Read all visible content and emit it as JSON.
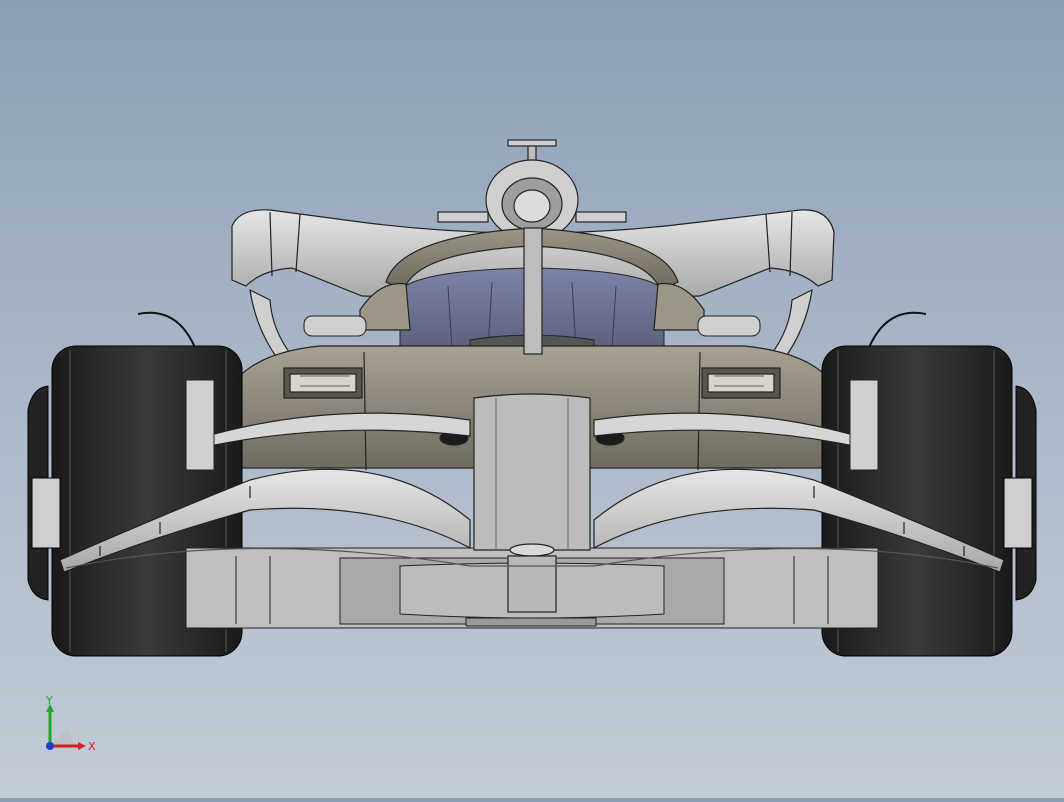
{
  "viewport": {
    "background_top": "#8d9fb6",
    "background_bottom": "#c3ccd6",
    "model_fill": "#bdbdbd",
    "body_shade": "#8f8a7a",
    "tire_color": "#2a2a2a",
    "edge_color": "#1e1e1e"
  },
  "triad": {
    "x_label": "X",
    "y_label": "Y",
    "x_color": "#d62020",
    "y_color": "#1fa82a",
    "z_color": "#1f3fd0"
  }
}
